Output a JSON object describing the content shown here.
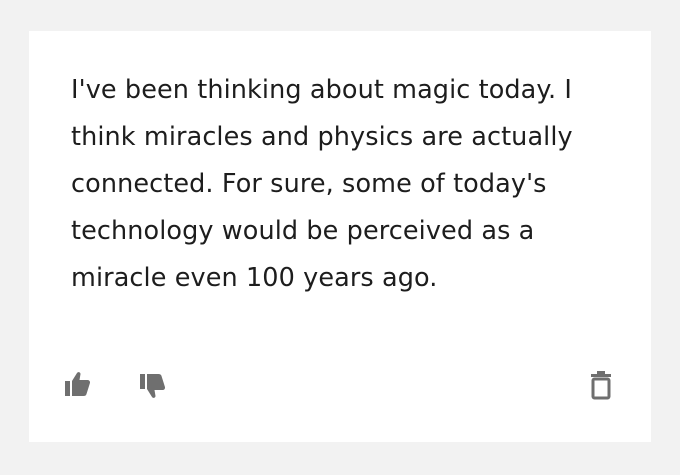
{
  "message": {
    "text": "I've been thinking about magic today. I think miracles and physics are actually connected. For sure, some of today's technology would be perceived as a miracle even 100 years ago."
  },
  "actions": {
    "like_icon": "thumbs-up-icon",
    "dislike_icon": "thumbs-down-icon",
    "delete_icon": "trash-icon"
  },
  "colors": {
    "background": "#f2f2f2",
    "card": "#ffffff",
    "text": "#1d1d1d",
    "icon": "#6f6f6f"
  }
}
